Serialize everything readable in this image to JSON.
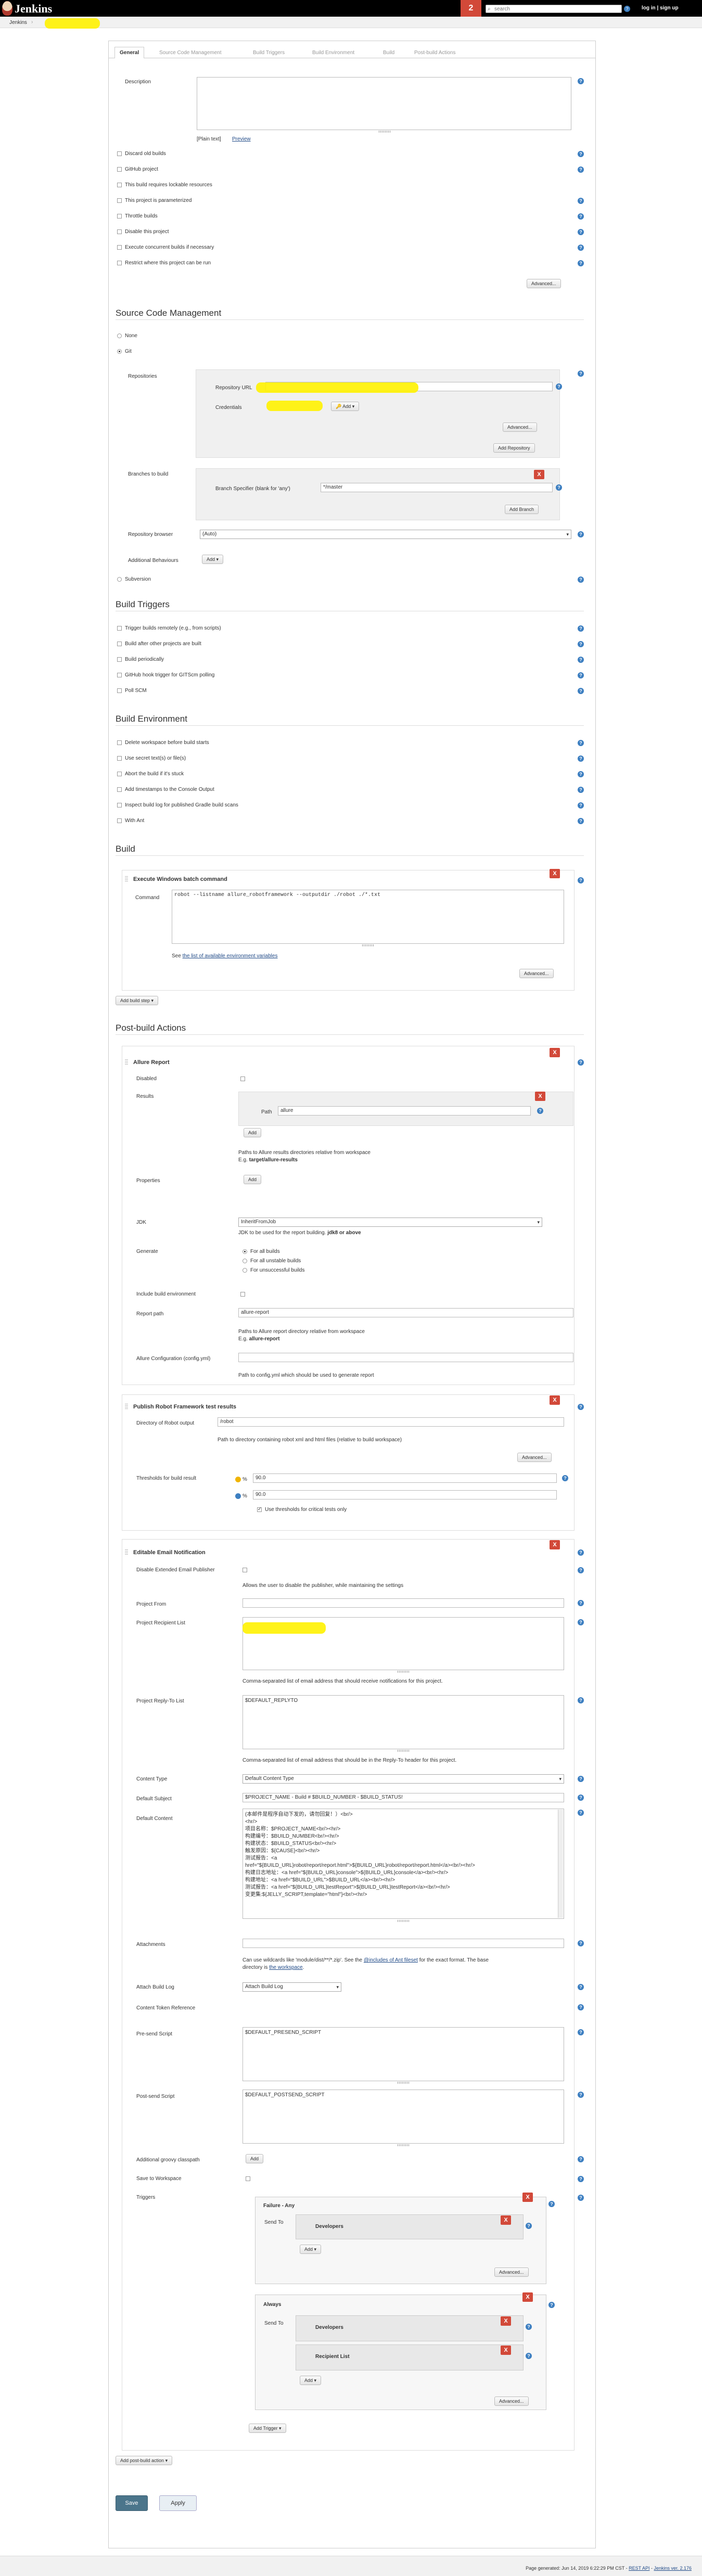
{
  "header": {
    "brand": "Jenkins",
    "notification_count": "2",
    "search_placeholder": "search",
    "login_link": "log in | sign up"
  },
  "breadcrumb": {
    "root": "Jenkins",
    "separator": "›"
  },
  "tabs": [
    "General",
    "Source Code Management",
    "Build Triggers",
    "Build Environment",
    "Build",
    "Post-build Actions"
  ],
  "general": {
    "description_label": "Description",
    "plain_text": "[Plain text]",
    "preview_link": "Preview",
    "options": [
      "Discard old builds",
      "GitHub project",
      "This build requires lockable resources",
      "This project is parameterized",
      "Throttle builds",
      "Disable this project",
      "Execute concurrent builds if necessary",
      "Restrict where this project can be run"
    ],
    "advanced_button": "Advanced..."
  },
  "scm": {
    "title": "Source Code Management",
    "none_label": "None",
    "git_label": "Git",
    "repositories_label": "Repositories",
    "repo_url_label": "Repository URL",
    "credentials_label": "Credentials",
    "add_button": "Add",
    "advanced_button": "Advanced...",
    "add_repository_button": "Add Repository",
    "branches_label": "Branches to build",
    "branch_specifier_label": "Branch Specifier (blank for 'any')",
    "branch_value": "*/master",
    "add_branch_button": "Add Branch",
    "repo_browser_label": "Repository browser",
    "repo_browser_value": "(Auto)",
    "additional_behaviours_label": "Additional Behaviours",
    "add_behaviour_button": "Add",
    "subversion_label": "Subversion"
  },
  "triggers": {
    "title": "Build Triggers",
    "options": [
      "Trigger builds remotely (e.g., from scripts)",
      "Build after other projects are built",
      "Build periodically",
      "GitHub hook trigger for GITScm polling",
      "Poll SCM"
    ]
  },
  "environment": {
    "title": "Build Environment",
    "options": [
      "Delete workspace before build starts",
      "Use secret text(s) or file(s)",
      "Abort the build if it's stuck",
      "Add timestamps to the Console Output",
      "Inspect build log for published Gradle build scans",
      "With Ant"
    ]
  },
  "build": {
    "title": "Build",
    "step_title": "Execute Windows batch command",
    "command_label": "Command",
    "command_value": "robot --listname allure_robotframework --outputdir ./robot ./*.txt",
    "env_vars_prefix": "See ",
    "env_vars_link": "the list of available environment variables",
    "advanced_button": "Advanced...",
    "add_step_button": "Add build step"
  },
  "post_build": {
    "title": "Post-build Actions",
    "allure": {
      "title": "Allure Report",
      "disabled_label": "Disabled",
      "results_label": "Results",
      "path_label": "Path",
      "path_value": "allure",
      "add_button": "Add",
      "paths_hint": "Paths to Allure results directories relative from workspace",
      "paths_eg_prefix": "E.g. ",
      "paths_eg_value": "target/allure-results",
      "properties_label": "Properties",
      "properties_add": "Add",
      "jdk_label": "JDK",
      "jdk_value": "InheritFromJob",
      "jdk_hint_prefix": "JDK to be used for the report building. ",
      "jdk_hint_bold": "jdk8 or above",
      "generate_label": "Generate",
      "generate_options": [
        "For all builds",
        "For all unstable builds",
        "For unsuccessful builds"
      ],
      "include_env_label": "Include build environment",
      "report_path_label": "Report path",
      "report_path_value": "allure-report",
      "report_path_hint": "Paths to Allure report directory relative from workspace",
      "report_path_eg_prefix": "E.g. ",
      "report_path_eg_value": "allure-report",
      "config_label": "Allure Configuration (config.yml)",
      "config_hint": "Path to config.yml which should be used to generate report"
    },
    "robot": {
      "title": "Publish Robot Framework test results",
      "dir_label": "Directory of Robot output",
      "dir_value": "/robot",
      "dir_hint": "Path to directory containing robot xml and html files (relative to build workspace)",
      "advanced_button": "Advanced...",
      "thresholds_label": "Thresholds for build result",
      "threshold_1": "90.0",
      "threshold_2": "90.0",
      "percent_sign": "%",
      "critical_label": "Use thresholds for critical tests only"
    },
    "email": {
      "title": "Editable Email Notification",
      "disable_label": "Disable Extended Email Publisher",
      "disable_hint": "Allows the user to disable the publisher, while maintaining the settings",
      "from_label": "Project From",
      "recipient_label": "Project Recipient List",
      "recipient_hint": "Comma-separated list of email address that should receive notifications for this project.",
      "reply_label": "Project Reply-To List",
      "reply_value": "$DEFAULT_REPLYTO",
      "reply_hint": "Comma-separated list of email address that should be in the Reply-To header for this project.",
      "content_type_label": "Content Type",
      "content_type_value": "Default Content Type",
      "subject_label": "Default Subject",
      "subject_value": "$PROJECT_NAME - Build # $BUILD_NUMBER - $BUILD_STATUS!",
      "content_label": "Default Content",
      "content_lines": [
        "(本邮件是程序自动下发的，请勿回复！）<br/>",
        "<hr/>",
        "项目名称：$PROJECT_NAME<br/><hr/>",
        "构建编号：$BUILD_NUMBER<br/><hr/>",
        "构建状态：$BUILD_STATUS<br/><hr/>",
        "触发原因：${CAUSE}<br/><hr/>",
        "测试报告：<a",
        "href=\"${BUILD_URL}robot/report/report.html\">${BUILD_URL}robot/report/report.html</a><br/><hr/>",
        "构建日志地址：<a href=\"${BUILD_URL}console\">${BUILD_URL}console</a><br/><hr/>",
        "构建地址：<a href=\"$BUILD_URL\">$BUILD_URL</a><br/><hr/>",
        "测试报告：<a href=\"${BUILD_URL}testReport\">${BUILD_URL}testReport</a><br/><hr/>",
        "变更集:${JELLY_SCRIPT,template=\"html\"}<br/><hr/>"
      ],
      "attachments_label": "Attachments",
      "attachments_hint_1": "Can use wildcards like 'module/dist/**/*.zip'. See the ",
      "attachments_link": "@includes of Ant fileset",
      "attachments_hint_2": " for the exact format. The base",
      "attachments_hint_3": "directory is ",
      "workspace_link": "the workspace",
      "attachments_hint_4": ".",
      "attach_log_label": "Attach Build Log",
      "attach_log_value": "Attach Build Log",
      "token_label": "Content Token Reference",
      "presend_label": "Pre-send Script",
      "presend_value": "$DEFAULT_PRESEND_SCRIPT",
      "postsend_label": "Post-send Script",
      "postsend_value": "$DEFAULT_POSTSEND_SCRIPT",
      "classpath_label": "Additional groovy classpath",
      "classpath_add": "Add",
      "save_ws_label": "Save to Workspace",
      "triggers_label": "Triggers",
      "triggers": [
        {
          "name": "Failure - Any",
          "send_to_label": "Send To",
          "recipients": [
            "Developers"
          ],
          "add_button": "Add",
          "advanced_button": "Advanced..."
        },
        {
          "name": "Always",
          "send_to_label": "Send To",
          "recipients": [
            "Developers",
            "Recipient List"
          ],
          "add_button": "Add",
          "advanced_button": "Advanced..."
        }
      ],
      "add_trigger_button": "Add Trigger"
    },
    "add_action_button": "Add post-build action"
  },
  "form_buttons": {
    "save": "Save",
    "apply": "Apply"
  },
  "footer": {
    "generated_text": "Page generated: Jun 14, 2019 6:22:29 PM CST",
    "separator": " - ",
    "rest_api": "REST API",
    "version": "Jenkins ver. 2.176"
  },
  "colors": {
    "header_bg": "#000000",
    "notification_red": "#d24939",
    "help_blue": "#3d7fc1",
    "redaction_yellow": "#fff200",
    "save_blue": "#4b758b"
  }
}
